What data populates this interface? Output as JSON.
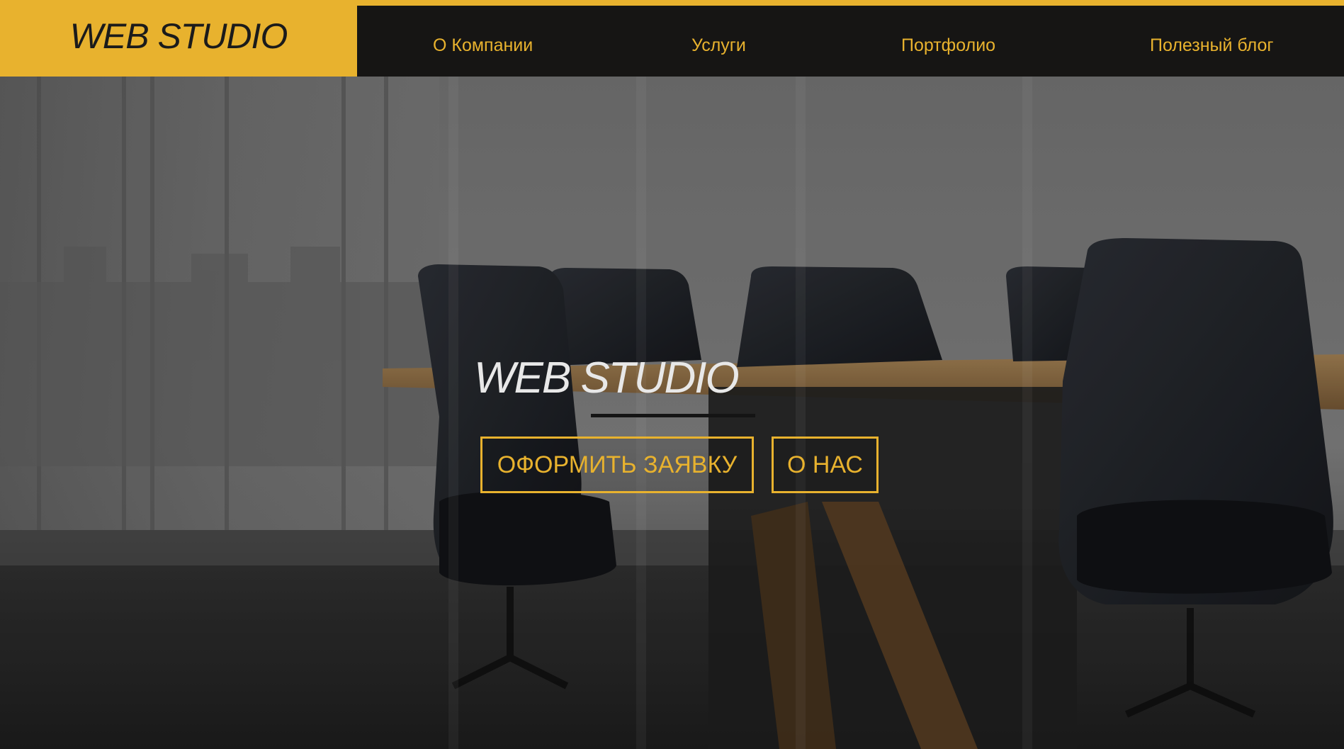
{
  "header": {
    "logo": "WEB STUDIO",
    "nav": [
      {
        "label": "О Компании"
      },
      {
        "label": "Услуги"
      },
      {
        "label": "Портфолио"
      },
      {
        "label": "Полезный блог"
      }
    ]
  },
  "hero": {
    "title": "WEB STUDIO",
    "buttons": {
      "order": "ОФОРМИТЬ ЗАЯВКУ",
      "about": "О НАС"
    },
    "background_image": "conference-room-photo"
  },
  "colors": {
    "accent": "#e8b22e",
    "nav_background": "#161514",
    "logo_text": "#1b1b1b",
    "hero_title": "#e8e8e8"
  }
}
